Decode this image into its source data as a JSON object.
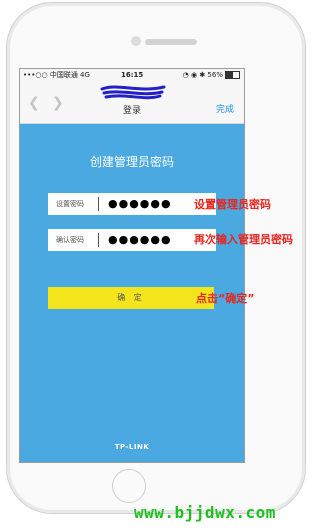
{
  "status_bar": {
    "carrier": "•••○○ 中国联通  4G",
    "time": "16:15",
    "indicators": "◔ ◉ ✱ 56%"
  },
  "nav": {
    "title": "登录",
    "done": "完成",
    "back_icon": "chevron-left-icon",
    "forward_icon": "chevron-right-icon"
  },
  "page": {
    "title": "创建管理员密码"
  },
  "fields": [
    {
      "label": "设置密码",
      "value": "●●●●●●"
    },
    {
      "label": "确认密码",
      "value": "●●●●●●"
    }
  ],
  "confirm_button": "确 定",
  "brand": "TP-LINK",
  "annotations": [
    "设置管理员密码",
    "再次输入管理员密码",
    "点击“确定”"
  ],
  "watermark": "www.bjjdwx.com",
  "colors": {
    "screen_bg": "#4aa9e0",
    "button_bg": "#f4e41b",
    "annotation": "#e8251f",
    "done_link": "#1b8fe4",
    "watermark": "#1fbf1f"
  }
}
